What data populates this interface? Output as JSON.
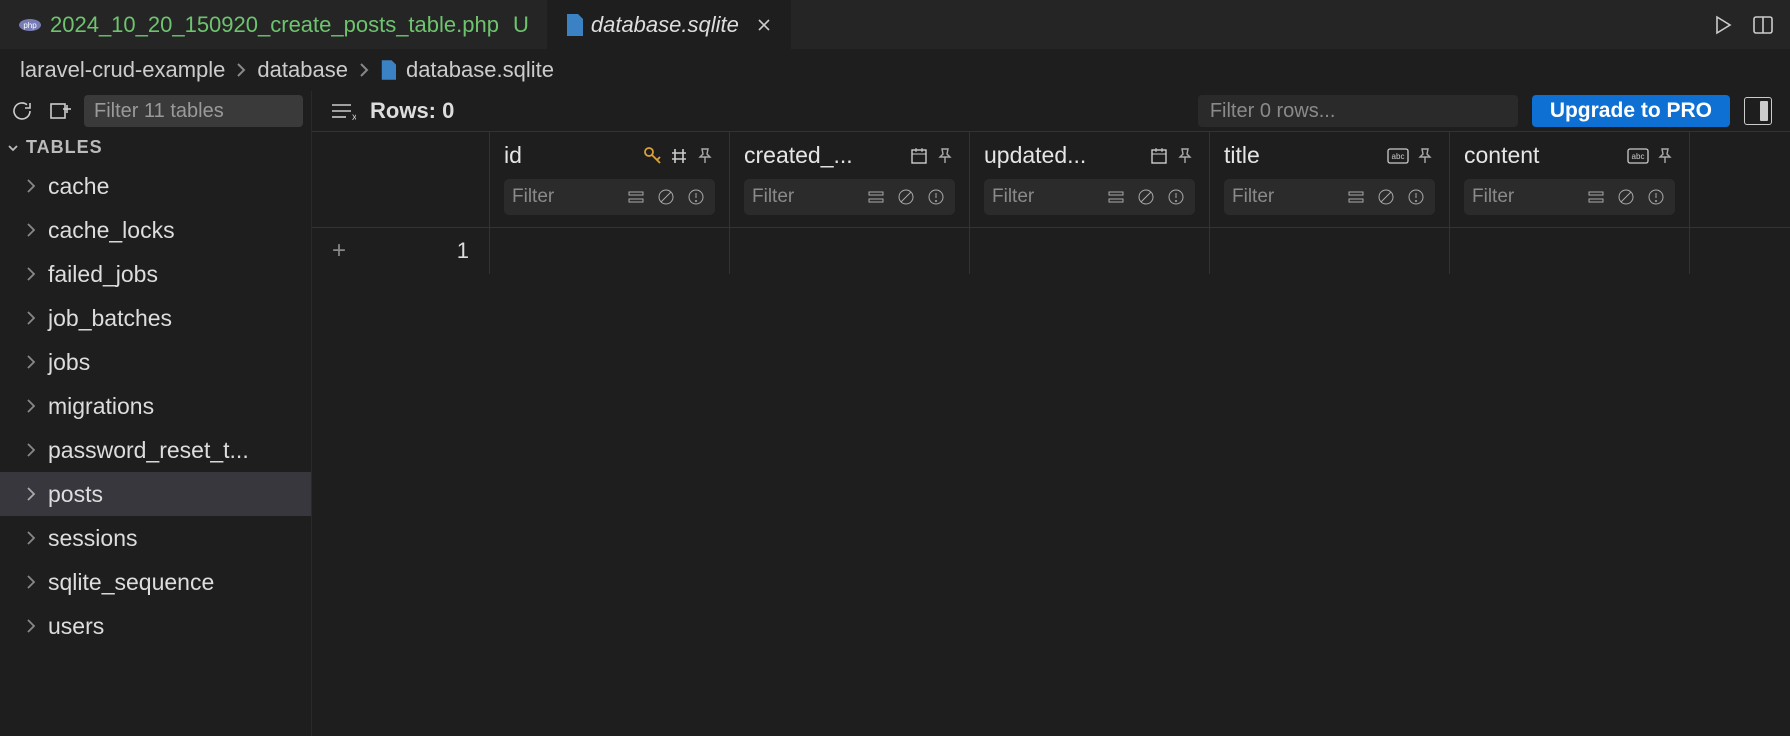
{
  "tabs": {
    "items": [
      {
        "label": "2024_10_20_150920_create_posts_table.php",
        "status": "U",
        "active": false,
        "modified": true,
        "file_icon": "php"
      },
      {
        "label": "database.sqlite",
        "status": "",
        "active": true,
        "modified": false,
        "file_icon": "db"
      }
    ]
  },
  "breadcrumb": {
    "segments": [
      "laravel-crud-example",
      "database",
      "database.sqlite"
    ]
  },
  "sidebar": {
    "filter_placeholder": "Filter 11 tables",
    "section": "TABLES",
    "tables": [
      "cache",
      "cache_locks",
      "failed_jobs",
      "job_batches",
      "jobs",
      "migrations",
      "password_reset_t...",
      "posts",
      "sessions",
      "sqlite_sequence",
      "users"
    ],
    "selected_index": 7
  },
  "content": {
    "rows_label": "Rows:",
    "rows_count": "0",
    "filter_rows_placeholder": "Filter 0 rows...",
    "upgrade_label": "Upgrade to PRO"
  },
  "columns": [
    {
      "name": "id",
      "type": "pk",
      "filter_placeholder": "Filter"
    },
    {
      "name": "created_...",
      "type": "date",
      "filter_placeholder": "Filter"
    },
    {
      "name": "updated...",
      "type": "date",
      "filter_placeholder": "Filter"
    },
    {
      "name": "title",
      "type": "text",
      "filter_placeholder": "Filter"
    },
    {
      "name": "content",
      "type": "text",
      "filter_placeholder": "Filter"
    }
  ],
  "rows": [
    {
      "num": "1"
    }
  ]
}
